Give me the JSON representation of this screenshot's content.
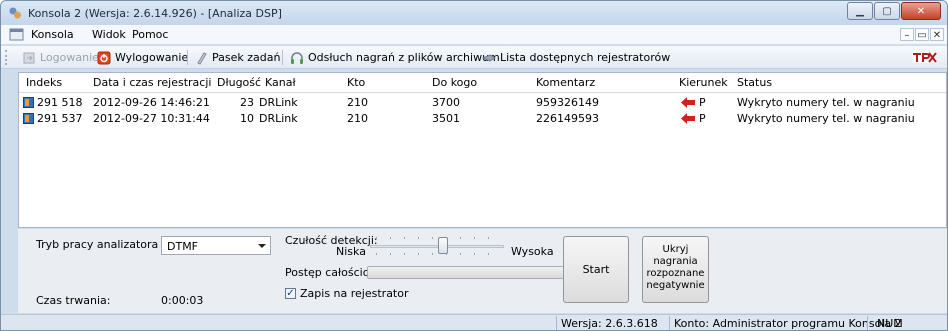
{
  "window": {
    "title": "Konsola 2 (Wersja:  2.6.14.926) - [Analiza DSP]",
    "controls": {
      "minimize": "▁",
      "maximize": "▢",
      "close": "✕"
    }
  },
  "menubar": {
    "items": [
      "Konsola",
      "Widok",
      "Pomoc"
    ],
    "mdi_controls": [
      "–",
      "▭",
      "✕"
    ]
  },
  "toolbar": {
    "login": "Logowanie",
    "logout": "Wylogowanie",
    "taskbar": "Pasek zadań",
    "archive_listen": "Odsłuch nagrań z plików archiwum",
    "recorders_list": "Lista dostępnych rejestratorów",
    "icons": [
      "login-icon",
      "logout-icon",
      "taskbar-icon",
      "headphones-icon",
      "recorders-icon",
      "brand-logo"
    ]
  },
  "grid": {
    "columns": [
      "Indeks",
      "Data i czas rejestracji",
      "Długość",
      "Kanał",
      "Kto",
      "Do kogo",
      "Komentarz",
      "Kierunek",
      "Status"
    ],
    "rows": [
      {
        "index": "291 518",
        "datetime": "2012-09-26 14:46:21",
        "length": "23",
        "channel": "DRLink",
        "who": "210",
        "to_whom": "3700",
        "comment": "959326149",
        "direction": "P",
        "status": "Wykryto numery tel. w nagraniu"
      },
      {
        "index": "291 537",
        "datetime": "2012-09-27 10:31:44",
        "length": "10",
        "channel": "DRLink",
        "who": "210",
        "to_whom": "3501",
        "comment": "226149593",
        "direction": "P",
        "status": "Wykryto numery tel. w nagraniu"
      }
    ]
  },
  "panel": {
    "mode_label": "Tryb pracy analizatora",
    "mode_value": "DTMF",
    "sensitivity_label": "Czułość detekcji:",
    "sensitivity_low": "Niska",
    "sensitivity_high": "Wysoka",
    "sensitivity_level": 0.55,
    "progress_label": "Postęp całościowy:",
    "progress_value": 0,
    "record_checkbox_label": "Zapis na rejestrator",
    "record_checked": true,
    "duration_label": "Czas trwania:",
    "duration_value": "0:00:03",
    "start_button": "Start",
    "hide_button": "Ukryj\nnagrania\nrozpoznane\nnegatywnie"
  },
  "statusbar": {
    "version": "Wersja: 2.6.3.618",
    "account": "Konto: Administrator programu Konsola 2",
    "num": "NUM"
  },
  "colors": {
    "accent": "#c4412c",
    "direction_arrow": "#d61e1e",
    "brand": "#b01c1c"
  }
}
